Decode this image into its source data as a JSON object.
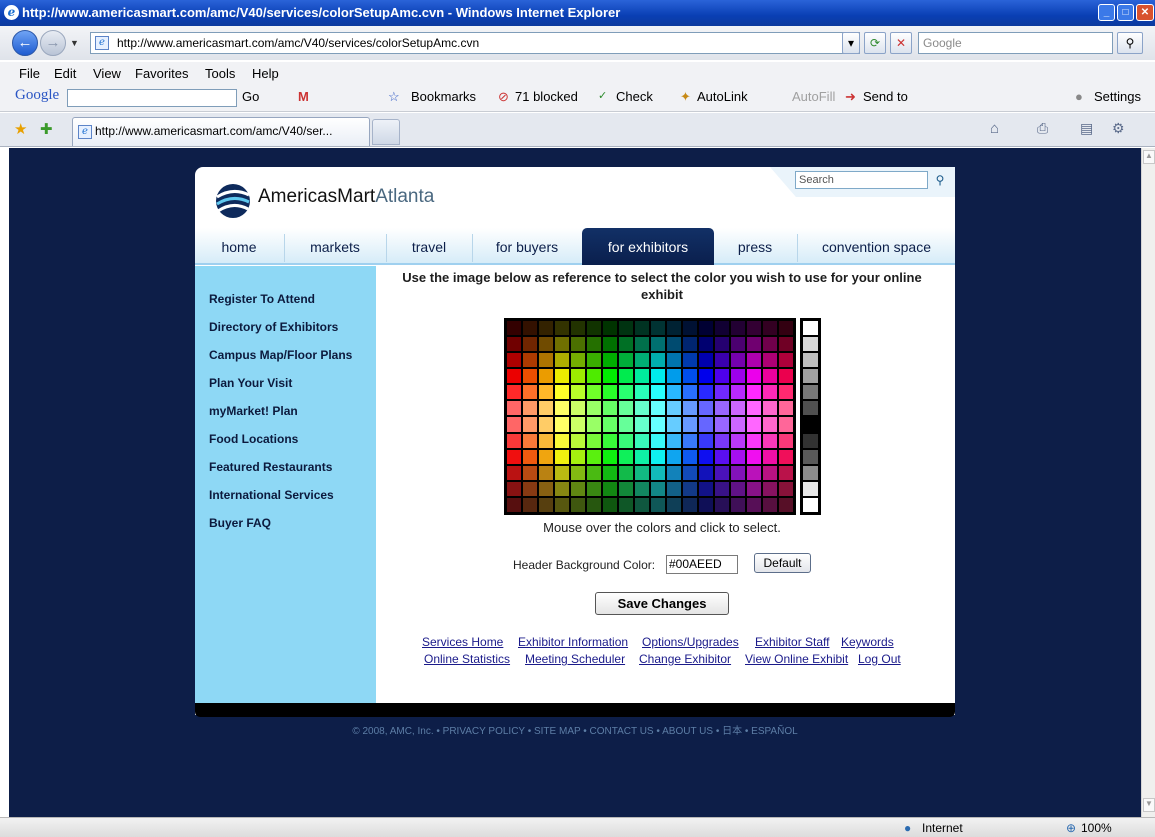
{
  "window": {
    "title": "http://www.americasmart.com/amc/V40/services/colorSetupAmc.cvn - Windows Internet Explorer"
  },
  "address_bar": {
    "url": "http://www.americasmart.com/amc/V40/services/colorSetupAmc.cvn",
    "search_placeholder": "Google"
  },
  "menu": [
    "File",
    "Edit",
    "View",
    "Favorites",
    "Tools",
    "Help"
  ],
  "google_toolbar": {
    "logo": "Google",
    "go_label": "Go",
    "bookmarks_label": "Bookmarks",
    "blocked_label": "71 blocked",
    "check_label": "Check",
    "autolink_label": "AutoLink",
    "autofill_label": "AutoFill",
    "sendto_label": "Send to",
    "settings_label": "Settings"
  },
  "tab": {
    "label": "http://www.americasmart.com/amc/V40/ser..."
  },
  "site": {
    "brand_main": "AmericasMart",
    "brand_sub": "Atlanta",
    "search_placeholder": "Search",
    "nav": [
      "home",
      "markets",
      "travel",
      "for buyers",
      "for exhibitors",
      "press",
      "convention space"
    ],
    "active_nav": "for exhibitors",
    "sidebar": [
      "Register To Attend",
      "Directory of Exhibitors",
      "Campus Map/Floor Plans",
      "Plan Your Visit",
      "myMarket! Plan",
      "Food Locations",
      "Featured Restaurants",
      "International Services",
      "Buyer FAQ"
    ],
    "copyright": "© 2008, AMC, Inc. • PRIVACY POLICY • SITE MAP • CONTACT US • ABOUT US • 日本 • ESPAÑOL"
  },
  "content": {
    "instruction": "Use the image below as reference to select the color you wish to use for your online exhibit",
    "hint": "Mouse over the colors and click to select.",
    "header_bg_label": "Header Background Color:",
    "header_bg_value": "#00AEED",
    "default_button": "Default",
    "save_button": "Save Changes",
    "links_row1": [
      "Services Home",
      "Exhibitor Information",
      "Options/Upgrades",
      "Exhibitor Staff",
      "Keywords"
    ],
    "links_row2": [
      "Online Statistics",
      "Meeting Scheduler",
      "Change Exhibitor",
      "View Online Exhibit",
      "Log Out"
    ]
  },
  "status_bar": {
    "zone": "Internet",
    "zoom": "100%"
  }
}
